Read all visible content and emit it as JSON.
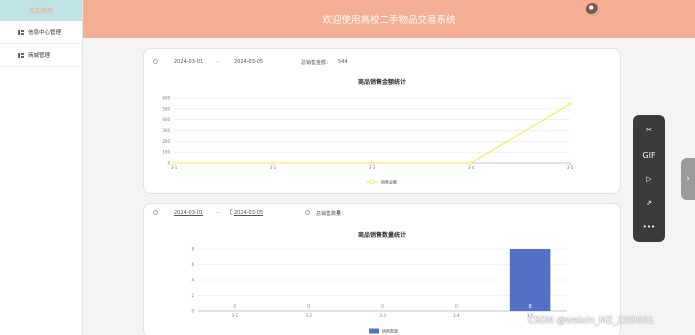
{
  "sidebar": {
    "logo": "欢迎使用",
    "items": [
      {
        "label": "信息中心管理"
      },
      {
        "label": "商城管理"
      }
    ]
  },
  "header": {
    "title": "欢迎使用高校二手物品交易系统"
  },
  "sales_card": {
    "start_date": "2024-03-01",
    "separator": "-",
    "end_date": "2024-03-05",
    "total_label": "总销售金额：",
    "total_value": "544",
    "chart_title": "商品销售金额统计",
    "legend": "销售金额"
  },
  "quantity_card": {
    "start_date": "2024-03-01",
    "separator": "-",
    "end_date": "2024-03-05",
    "total_label": "总销售数量：",
    "total_value": "8",
    "chart_title": "商品销售数量统计",
    "legend": "销售数量"
  },
  "chart_data": [
    {
      "type": "line",
      "title": "商品销售金额统计",
      "categories": [
        "3-1",
        "3-2",
        "3-3",
        "3-4",
        "3-5"
      ],
      "series": [
        {
          "name": "销售金额",
          "values": [
            0,
            0,
            0,
            0,
            544
          ]
        }
      ],
      "yticks": [
        0,
        100,
        200,
        300,
        400,
        500,
        600
      ],
      "ylim": [
        0,
        600
      ],
      "grid": true,
      "color": "#f5e84a",
      "legend_position": "bottom"
    },
    {
      "type": "bar",
      "title": "商品销售数量统计",
      "categories": [
        "3-1",
        "3-2",
        "3-3",
        "3-4",
        "3-5"
      ],
      "series": [
        {
          "name": "销售数量",
          "values": [
            0,
            0,
            0,
            0,
            8
          ]
        }
      ],
      "yticks": [
        0,
        2,
        4,
        6,
        8
      ],
      "ylim": [
        0,
        8
      ],
      "grid": true,
      "color": "#5470c6",
      "legend_position": "bottom"
    }
  ],
  "toolbar": {
    "items": [
      {
        "icon": "scissors-icon",
        "label": "✂"
      },
      {
        "icon": "gif-icon",
        "label": "GIF"
      },
      {
        "icon": "record-icon",
        "label": "▷"
      },
      {
        "icon": "share-icon",
        "label": "⇗"
      },
      {
        "icon": "more-icon",
        "label": "•••"
      }
    ],
    "side_tab": "›"
  },
  "watermark": "CSDN @weixin_MZ_ZXD001"
}
